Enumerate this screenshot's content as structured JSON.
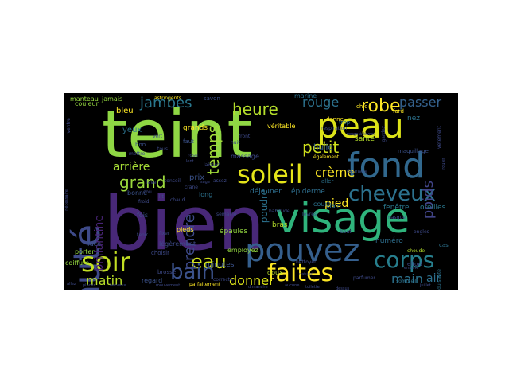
{
  "palette": {
    "background": "#000000",
    "figure_background": "#ffffff",
    "viridis": [
      "#440154",
      "#482878",
      "#3e4989",
      "#31688e",
      "#26828e",
      "#1f9e89",
      "#35b779",
      "#6ece58",
      "#b5de2b",
      "#fde725"
    ]
  },
  "words": [
    {
      "text": "bien",
      "color": "#482878",
      "rank": 1
    },
    {
      "text": "teint",
      "color": "#8fd744",
      "rank": 2
    },
    {
      "text": "peau",
      "color": "#dde318",
      "rank": 3
    },
    {
      "text": "visage",
      "color": "#2fb47c",
      "rank": 4
    },
    {
      "text": "beauté",
      "color": "#3e4a89",
      "rank": 5
    },
    {
      "text": "fond",
      "color": "#31688e",
      "rank": 6
    },
    {
      "text": "pouvez",
      "color": "#355f8d",
      "rank": 7
    },
    {
      "text": "soir",
      "color": "#c2df23",
      "rank": 8
    },
    {
      "text": "soleil",
      "color": "#e5e419",
      "rank": 9
    },
    {
      "text": "faites",
      "color": "#fde725",
      "rank": 10
    },
    {
      "text": "corps",
      "color": "#277f8e",
      "rank": 11
    },
    {
      "text": "cheveux",
      "color": "#2c728e",
      "rank": 12
    },
    {
      "text": "eau",
      "color": "#d2e21b",
      "rank": 13
    },
    {
      "text": "bain",
      "color": "#3b528b",
      "rank": 14
    },
    {
      "text": "robe",
      "color": "#fde725",
      "rank": 15
    },
    {
      "text": "heure",
      "color": "#b5de2b",
      "rank": 16
    },
    {
      "text": "temps",
      "color": "#a0da39",
      "rank": 17
    },
    {
      "text": "grand",
      "color": "#9bd93c",
      "rank": 18
    },
    {
      "text": "petit",
      "color": "#d0e11c",
      "rank": 19
    },
    {
      "text": "jambes",
      "color": "#2a788e",
      "rank": 20
    },
    {
      "text": "poids",
      "color": "#414487",
      "rank": 21
    },
    {
      "text": "rouge",
      "color": "#2c728e",
      "rank": 22
    },
    {
      "text": "passer",
      "color": "#34618d",
      "rank": 23
    },
    {
      "text": "prendre",
      "color": "#3e4a89",
      "rank": 24
    },
    {
      "text": "matin",
      "color": "#b8de29",
      "rank": 25
    },
    {
      "text": "donner",
      "color": "#dde318",
      "rank": 26
    },
    {
      "text": "main",
      "color": "#2c728e",
      "rank": 27
    },
    {
      "text": "crème",
      "color": "#fde725",
      "rank": 28
    },
    {
      "text": "brillantine",
      "color": "#482475",
      "rank": 29
    },
    {
      "text": "arrière",
      "color": "#a5db36",
      "rank": 30
    },
    {
      "text": "pied",
      "color": "#fde725",
      "rank": 31
    },
    {
      "text": "air",
      "color": "#2d708e",
      "rank": 32
    },
    {
      "text": "poudre",
      "color": "#2c728e",
      "rank": 33
    },
    {
      "text": "déjeuner",
      "color": "#2e6e8e",
      "rank": 34
    },
    {
      "text": "épiderme",
      "color": "#2e6e8e",
      "rank": 35
    },
    {
      "text": "huile",
      "color": "#35608d",
      "rank": 36
    },
    {
      "text": "fenêtre",
      "color": "#2a788e",
      "rank": 37
    },
    {
      "text": "oreilles",
      "color": "#2a788e",
      "rank": 38
    },
    {
      "text": "minutes",
      "color": "#3b528b",
      "rank": 39
    },
    {
      "text": "épaules",
      "color": "#95d840",
      "rank": 40
    },
    {
      "text": "numéro",
      "color": "#2e6e8e",
      "rank": 41
    },
    {
      "text": "bras",
      "color": "#b5de2b",
      "rank": 42
    },
    {
      "text": "yeux",
      "color": "#2c728e",
      "rank": 43
    },
    {
      "text": "prix",
      "color": "#3b528b",
      "rank": 44
    },
    {
      "text": "nez",
      "color": "#2c728e",
      "rank": 45
    },
    {
      "text": "santé",
      "color": "#b5de2b",
      "rank": 46
    },
    {
      "text": "clair",
      "color": "#2c728e",
      "rank": 47
    },
    {
      "text": "long",
      "color": "#2c728e",
      "rank": 48
    },
    {
      "text": "doux",
      "color": "#b5de2b",
      "rank": 49
    },
    {
      "text": "court",
      "color": "#2c728e",
      "rank": 50
    },
    {
      "text": "bonne",
      "color": "#3b528b",
      "rank": 51
    },
    {
      "text": "fois",
      "color": "#3b528b",
      "rank": 52
    },
    {
      "text": "face",
      "color": "#3b528b",
      "rank": 53
    },
    {
      "text": "porter",
      "color": "#95d840",
      "rank": 54
    },
    {
      "text": "coiffure",
      "color": "#95d840",
      "rank": 55
    },
    {
      "text": "regard",
      "color": "#3b528b",
      "rank": 56
    },
    {
      "text": "manteau",
      "color": "#95d840",
      "rank": 57
    },
    {
      "text": "jamais",
      "color": "#95d840",
      "rank": 58
    },
    {
      "text": "couleur",
      "color": "#95d840",
      "rank": 59
    },
    {
      "text": "bleu",
      "color": "#fde725",
      "rank": 60
    },
    {
      "text": "employez",
      "color": "#95d840",
      "rank": 61
    },
    {
      "text": "pieds",
      "color": "#fde725",
      "rank": 62
    },
    {
      "text": "grands",
      "color": "#fde725",
      "rank": 63
    },
    {
      "text": "véritable",
      "color": "#fde725",
      "rank": 64
    },
    {
      "text": "marine",
      "color": "#2c728e",
      "rank": 65
    },
    {
      "text": "légèrement",
      "color": "#3e4a89",
      "rank": 66
    },
    {
      "text": "massage",
      "color": "#3e4a89",
      "rank": 67
    },
    {
      "text": "choisir",
      "color": "#3e4a89",
      "rank": 68
    },
    {
      "text": "brosse",
      "color": "#3e4a89",
      "rank": 69
    },
    {
      "text": "effort",
      "color": "#3e4a89",
      "rank": 70
    },
    {
      "text": "trop",
      "color": "#2c728e",
      "rank": 71
    },
    {
      "text": "aller",
      "color": "#2c728e",
      "rank": 72
    },
    {
      "text": "fard",
      "color": "#fde725",
      "rank": 73
    },
    {
      "text": "chic",
      "color": "#fde725",
      "rank": 74
    },
    {
      "text": "faut",
      "color": "#3b528b",
      "rank": 75
    },
    {
      "text": "cas",
      "color": "#2c728e",
      "rank": 76
    },
    {
      "text": "donne",
      "color": "#fde725",
      "rank": 77
    },
    {
      "text": "savon",
      "color": "#3b528b",
      "rank": 78
    },
    {
      "text": "astringents",
      "color": "#fde725",
      "rank": 79
    },
    {
      "text": "correcte",
      "color": "#3e4a89",
      "rank": 80
    },
    {
      "text": "parfaitement",
      "color": "#fde725",
      "rank": 81
    },
    {
      "text": "également",
      "color": "#fde725",
      "rank": 82
    },
    {
      "text": "choude",
      "color": "#b5de2b",
      "rank": 83
    },
    {
      "text": "nettoyer",
      "color": "#3e4a89",
      "rank": 84
    },
    {
      "text": "parfumer",
      "color": "#3e4a89",
      "rank": 85
    },
    {
      "text": "séduisante",
      "color": "#2c728e",
      "rank": 86
    },
    {
      "text": "sommeil",
      "color": "#2c728e",
      "rank": 87
    },
    {
      "text": "respiration",
      "color": "#3e4a89",
      "rank": 88
    },
    {
      "text": "maquillage",
      "color": "#3b528b",
      "rank": 89
    },
    {
      "text": "donnera",
      "color": "#3b528b",
      "rank": 90
    },
    {
      "text": "laissez",
      "color": "#3e4a89",
      "rank": 91
    },
    {
      "text": "bon",
      "color": "#3b528b",
      "rank": 92
    },
    {
      "text": "lèvres",
      "color": "#3b528b",
      "rank": 93
    },
    {
      "text": "gardez",
      "color": "#3e4a89",
      "rank": 94
    },
    {
      "text": "ongles",
      "color": "#3e4a89",
      "rank": 95
    },
    {
      "text": "ventre",
      "color": "#3e4a89",
      "rank": 96
    },
    {
      "text": "masque",
      "color": "#3e4a89",
      "rank": 97
    },
    {
      "text": "semaine",
      "color": "#3e4a89",
      "rank": 98
    },
    {
      "text": "vêtement",
      "color": "#3e4a89",
      "rank": 99
    },
    {
      "text": "dimanche",
      "color": "#3e4a89",
      "rank": 100
    },
    {
      "text": "mouvement",
      "color": "#3e4a89",
      "rank": 101
    },
    {
      "text": "toilette",
      "color": "#3e4a89",
      "rank": 102
    },
    {
      "text": "rouler",
      "color": "#3e4a89",
      "rank": 103
    },
    {
      "text": "allez",
      "color": "#3e4a89",
      "rank": 104
    },
    {
      "text": "placer",
      "color": "#3e4a89",
      "rank": 105
    },
    {
      "text": "assez",
      "color": "#3e4a89",
      "rank": 106
    },
    {
      "text": "nuit",
      "color": "#3e4a89",
      "rank": 107
    },
    {
      "text": "juillet",
      "color": "#3e4a89",
      "rank": 108
    },
    {
      "text": "ensuite",
      "color": "#3e4a89",
      "rank": 109
    },
    {
      "text": "bout",
      "color": "#3e4a89",
      "rank": 110
    },
    {
      "text": "aucune",
      "color": "#3e4a89",
      "rank": 111
    },
    {
      "text": "dessus",
      "color": "#3e4a89",
      "rank": 112
    },
    {
      "text": "nerveux",
      "color": "#3e4a89",
      "rank": 113
    },
    {
      "text": "crâne",
      "color": "#3e4a89",
      "rank": 114
    },
    {
      "text": "fixer",
      "color": "#3e4a89",
      "rank": 115
    },
    {
      "text": "tenir",
      "color": "#3e4a89",
      "rank": 116
    },
    {
      "text": "laver",
      "color": "#3e4a89",
      "rank": 117
    },
    {
      "text": "lit",
      "color": "#3e4a89",
      "rank": 118
    },
    {
      "text": "habitude",
      "color": "#3e4a89",
      "rank": 119
    },
    {
      "text": "conseil",
      "color": "#3e4a89",
      "rank": 120
    },
    {
      "text": "front",
      "color": "#3e4a89",
      "rank": 121
    },
    {
      "text": "nécessaire",
      "color": "#3e4a89",
      "rank": 122
    },
    {
      "text": "mettre",
      "color": "#3e4a89",
      "rank": 123
    },
    {
      "text": "tous",
      "color": "#3e4a89",
      "rank": 124
    },
    {
      "text": "naturel",
      "color": "#3e4a89",
      "rank": 125
    },
    {
      "text": "sage",
      "color": "#3e4a89",
      "rank": 126
    },
    {
      "text": "lent",
      "color": "#3e4a89",
      "rank": 127
    },
    {
      "text": "cou",
      "color": "#3e4a89",
      "rank": 128
    },
    {
      "text": "chaud",
      "color": "#3e4a89",
      "rank": 129
    },
    {
      "text": "froid",
      "color": "#3e4a89",
      "rank": 130
    },
    {
      "text": "vert",
      "color": "#3e4a89",
      "rank": 131
    },
    {
      "text": "rose",
      "color": "#3e4a89",
      "rank": 132
    },
    {
      "text": "rouge à lèvres",
      "color": "#3e4a89",
      "rank": 133
    }
  ]
}
